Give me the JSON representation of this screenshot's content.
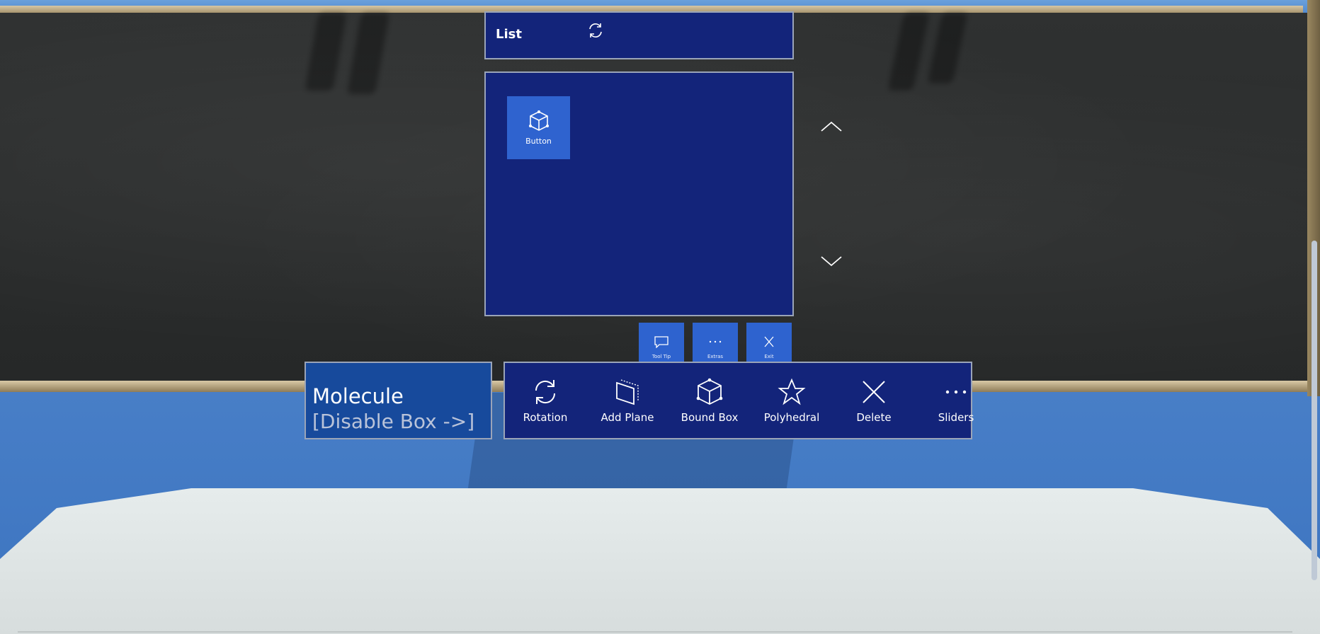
{
  "list_panel": {
    "title": "List",
    "refresh_icon": "refresh-icon",
    "grid_items": [
      {
        "label": "Button",
        "icon": "cube-icon"
      }
    ],
    "scroll_up_icon": "chevron-up-icon",
    "scroll_down_icon": "chevron-down-icon"
  },
  "mini_buttons": [
    {
      "label": "Tool Tip",
      "icon": "speech-bubble-icon"
    },
    {
      "label": "Extras",
      "icon": "more-icon"
    },
    {
      "label": "Exit",
      "icon": "close-icon"
    }
  ],
  "molecule_panel": {
    "title": "Molecule",
    "subtitle": "[Disable Box ->]"
  },
  "toolbar": {
    "items": [
      {
        "label": "Rotation",
        "icon": "rotation-icon"
      },
      {
        "label": "Add Plane",
        "icon": "plane-icon"
      },
      {
        "label": "Bound Box",
        "icon": "cube-icon"
      },
      {
        "label": "Polyhedral",
        "icon": "star-icon"
      },
      {
        "label": "Delete",
        "icon": "close-icon"
      },
      {
        "label": "Sliders",
        "icon": "more-icon"
      }
    ]
  },
  "colors": {
    "panel_bg": "#13247a",
    "button_bg": "#2f63cf",
    "molecule_bg": "#174a9c",
    "border": "#9aa4b8"
  }
}
